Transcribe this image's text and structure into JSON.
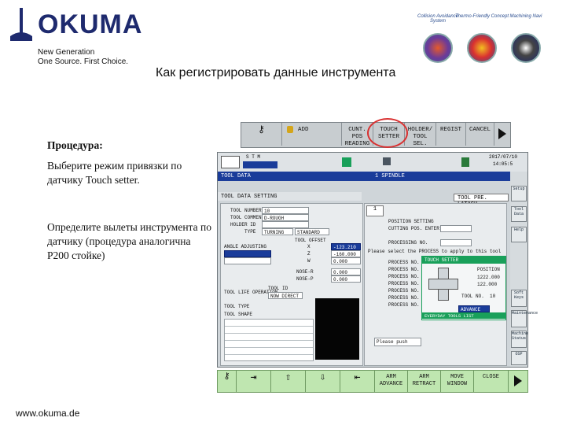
{
  "header": {
    "brand": "OKUMA",
    "tagline_line1": "New Generation",
    "tagline_line2": "One Source. First Choice.",
    "slide_title": "Как регистрировать данные инструмента",
    "badges": [
      "Collision Avoidance System",
      "Thermo-Friendly Concept",
      "Machining Navi"
    ]
  },
  "procedure": {
    "heading": "Процедура:",
    "step1": "Выберите режим привязки по датчику Touch setter.",
    "step2": "Определите вылеты инструмента по датчику (процедура аналогична P200 стойке)"
  },
  "footer": {
    "url": "www.okuma.de"
  },
  "toolbar": {
    "buttons": [
      {
        "label1": "ADD",
        "label2": ""
      },
      {
        "label1": "CUNT. POS",
        "label2": "READING"
      },
      {
        "label1": "TOUCH",
        "label2": "SETTER"
      },
      {
        "label1": "HOLDER/",
        "label2": "TOOL SEL."
      },
      {
        "label1": "REGIST",
        "label2": ""
      },
      {
        "label1": "CANCEL",
        "label2": ""
      }
    ],
    "accent_circle": "#d93030"
  },
  "screen": {
    "date": "2017/07/10",
    "time": "14:05:5",
    "mode_label": "S T M",
    "title": "TOOL DATA",
    "spindle": "1 SPINDLE",
    "panel_title": "TOOL DATA SETTING",
    "right_tab": "TOOL PRE. LATACH",
    "tab_number": "1",
    "left_fields": [
      {
        "label": "TOOL NUMBER",
        "value": "10"
      },
      {
        "label": "TOOL COMMENT",
        "value": "D-ROUGH"
      },
      {
        "label": "HOLDER ID",
        "value": ""
      },
      {
        "label": "TYPE",
        "value": "TURNING"
      }
    ],
    "standard": "STANDARD",
    "tool_offset": "TOOL OFFSET",
    "angle_label": "ANGLE ADJUSTING",
    "offset_rows": [
      {
        "axis": "X",
        "value": "-123.210"
      },
      {
        "axis": "Z",
        "value": "-160.000"
      },
      {
        "axis": "W",
        "value": "0.000"
      }
    ],
    "wear_rows": [
      {
        "label": "NOSE-R",
        "value": "0.000"
      },
      {
        "label": "NOSE-P",
        "value": "0.000"
      }
    ],
    "tool_life": "TOOL LIFE OPERATION",
    "tool_id": "TOOL ID",
    "now_direct": "NOW DIRECT",
    "tool_type": "TOOL TYPE",
    "tool_shape": "TOOL SHAPE",
    "process_title": "POSITION SETTING",
    "process_rows": [
      "CUTTING POS. ENTER",
      "PROCESSING NO.",
      "PROCESS NO.",
      "PROCESS NO.",
      "PROCESS NO.",
      "PROCESS NO.",
      "PROCESS NO.",
      "PROCESS NO.",
      "PROCESS NO."
    ],
    "position_label": "POSITION",
    "position_values": [
      "1222.000",
      "122.000",
      "10"
    ],
    "advance": "ADVANCE",
    "tool_no": "TOOL NO.",
    "info_message": "Please select the PROCESS to apply to this tool.",
    "prompt": "Please push",
    "green_label": "TOUCH SETTER",
    "green_bottom": "EVERYDAY TOOLS LIST",
    "side_buttons": [
      "Setup",
      "Tool Data",
      "Help",
      "Soft Keys",
      "Maintenance",
      "Machine Status",
      "OSP"
    ]
  },
  "function_keys": [
    {
      "label1": "",
      "label2": ""
    },
    {
      "label1": "",
      "label2": ""
    },
    {
      "label1": "",
      "label2": ""
    },
    {
      "label1": "",
      "label2": ""
    },
    {
      "label1": "",
      "label2": ""
    },
    {
      "label1": "ARM",
      "label2": "ADVANCE"
    },
    {
      "label1": "ARM",
      "label2": "RETRACT"
    },
    {
      "label1": "MOVE",
      "label2": "WINDOW"
    },
    {
      "label1": "CLOSE",
      "label2": ""
    }
  ],
  "colors": {
    "brand": "#1e2a6e",
    "screen_blue": "#1a3c9a",
    "fkey_green": "#bfe6b0",
    "status_green": "#19a05a"
  }
}
